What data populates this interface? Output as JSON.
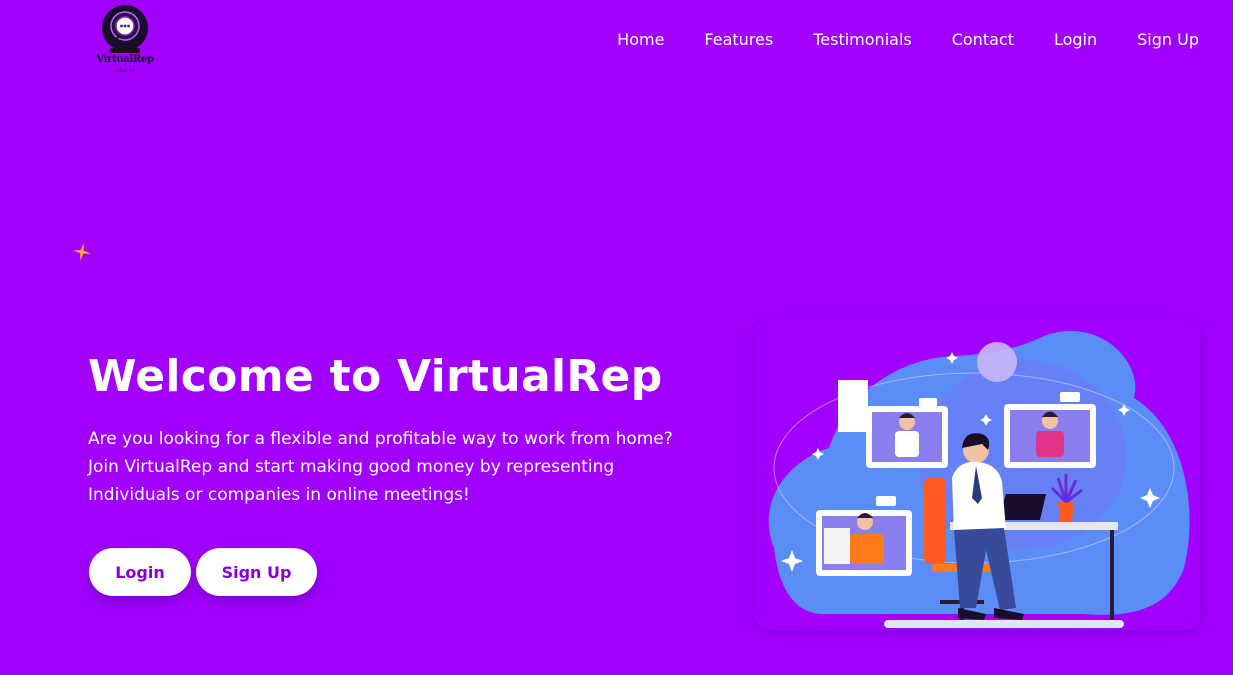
{
  "header": {
    "logo": {
      "icon": "webcam-chat-icon",
      "wordmark": "VirtualRep",
      "tagline": "virtual rep"
    },
    "nav": [
      {
        "label": "Home"
      },
      {
        "label": "Features"
      },
      {
        "label": "Testimonials"
      },
      {
        "label": "Contact"
      },
      {
        "label": "Login"
      },
      {
        "label": "Sign Up"
      }
    ]
  },
  "hero": {
    "title": "Welcome to VirtualRep",
    "description_lines": [
      "Are you looking for a flexible and profitable way to work from home?",
      "Join VirtualRep and start making good money by representing",
      "Individuals or companies in online meetings!"
    ],
    "buttons": {
      "login_label": "Login",
      "signup_label": "Sign Up"
    },
    "illustration": "video-meeting-illustration"
  },
  "colors": {
    "background": "#a100ff",
    "button_text": "#8a00d4",
    "sparkle": "#ffb020",
    "blob": "#5b8df7"
  }
}
